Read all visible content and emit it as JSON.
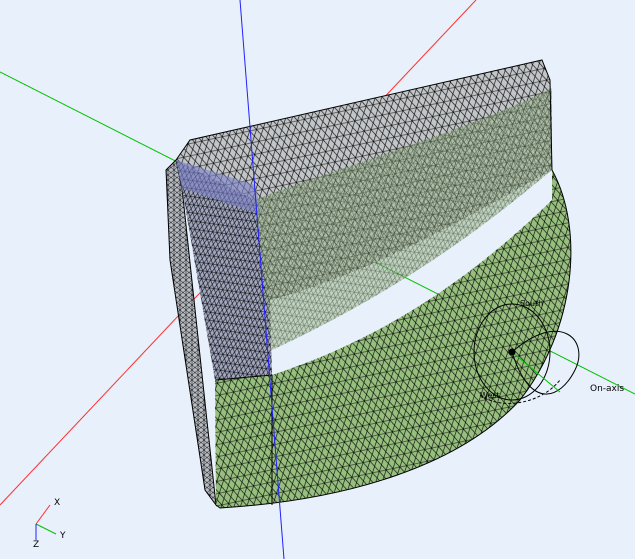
{
  "scene": {
    "background": "#e8f1fb",
    "mesh_colors": {
      "top_face": "#bfc3c6",
      "curved_face": "#9dba8e",
      "bottom_face": "#97c484",
      "inner_cut": "#9aa0b8",
      "wire": "#000000"
    },
    "axis_colors": {
      "x": "#ff3030",
      "y": "#00c000",
      "z": "#2020ff"
    }
  },
  "gizmo": {
    "label_south": "South",
    "label_west": "West",
    "label_on_axis": "On-axis"
  },
  "triad": {
    "x": "X",
    "y": "Y",
    "z": "Z"
  }
}
